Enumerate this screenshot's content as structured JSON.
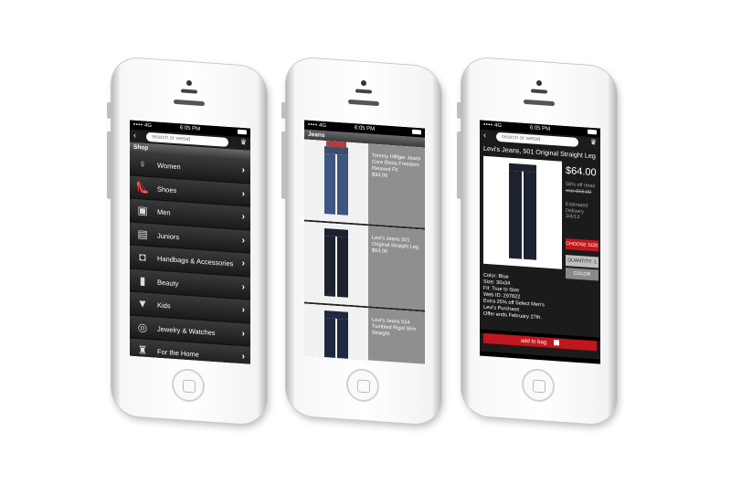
{
  "status": {
    "network": "4G",
    "time": "6:05 PM"
  },
  "search": {
    "placeholder": "search or webid"
  },
  "screen1": {
    "header": "Shop",
    "menu": [
      {
        "label": "Women",
        "icon": "dress-icon"
      },
      {
        "label": "Shoes",
        "icon": "shoe-icon"
      },
      {
        "label": "Men",
        "icon": "shirt-icon"
      },
      {
        "label": "Juniors",
        "icon": "jacket-icon"
      },
      {
        "label": "Handbags & Accessories",
        "icon": "handbag-icon"
      },
      {
        "label": "Beauty",
        "icon": "lipstick-icon"
      },
      {
        "label": "Kids",
        "icon": "tshirt-icon"
      },
      {
        "label": "Jewelry & Watches",
        "icon": "ring-icon"
      },
      {
        "label": "For the Home",
        "icon": "coffee-press-icon"
      }
    ]
  },
  "screen2": {
    "header": "Jeans",
    "products": [
      {
        "name": "Tommy Hilfiger Jeans Core Elvira Freedom Relaxed Fit",
        "price": "$34.99"
      },
      {
        "name": "Levi's Jeans 501 Original Straight Leg",
        "price": "$64.00"
      },
      {
        "name": "Levi's Jeans 514 Tumbled Rigid Slim Straight",
        "price": ""
      }
    ]
  },
  "screen3": {
    "title": "Levi's Jeans, 501 Original Straight Leg",
    "price": "$64.00",
    "pct_off": "56% off retail",
    "was_price": "was $58.00",
    "eta_label": "Estimated Delivery",
    "eta_date": "3/4/13",
    "choose_size": "CHOOSE SIZE",
    "quantity": "QUANTITY: 1",
    "color_button": "COLOR",
    "details": [
      "Color: Blue",
      "Size: 30x34",
      "Fit: True to Size",
      "Web ID: 297822",
      "Extra 25% off Select Men's",
      "Levi's Purchase.",
      "Offer ends February 27th."
    ],
    "add_to_bag": "add to bag"
  }
}
